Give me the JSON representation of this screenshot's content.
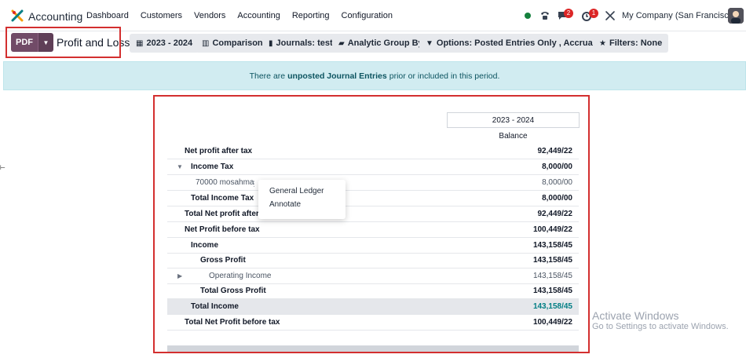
{
  "app": {
    "name": "Accounting"
  },
  "menu": [
    "Dashboard",
    "Customers",
    "Vendors",
    "Accounting",
    "Reporting",
    "Configuration"
  ],
  "systray": {
    "messages_count": "2",
    "activities_count": "1",
    "company": "My Company (San Francisco)"
  },
  "control": {
    "pdf_label": "PDF",
    "report_title": "Profit and Loss",
    "filters": [
      {
        "icon": "calendar-icon",
        "label": "2023 - 2024"
      },
      {
        "icon": "bar-chart-icon",
        "label": "Comparison"
      },
      {
        "icon": "book-icon",
        "label": "Journals: test"
      },
      {
        "icon": "folder-open-icon",
        "label": "Analytic Group By"
      },
      {
        "icon": "filter-icon",
        "label": "Options: Posted Entries Only , Accrual Basis"
      },
      {
        "icon": "star-icon",
        "label": "Filters: None"
      }
    ]
  },
  "alert": {
    "prefix": "There are",
    "link": "unposted Journal Entries",
    "suffix": "prior or included in this period."
  },
  "report": {
    "period": "2023 - 2024",
    "column_header": "Balance",
    "rows": [
      {
        "label": "Net profit after tax",
        "value": "92,449/22"
      },
      {
        "label": "Income Tax",
        "value": "8,000/00"
      },
      {
        "label": "70000 mosahma",
        "value": "8,000/00"
      },
      {
        "label": "Total Income Tax",
        "value": "8,000/00"
      },
      {
        "label": "Total Net profit after t",
        "value": "92,449/22"
      },
      {
        "label": "Net Profit before tax",
        "value": "100,449/22"
      },
      {
        "label": "Income",
        "value": "143,158/45"
      },
      {
        "label": "Gross Profit",
        "value": "143,158/45"
      },
      {
        "label": "Operating Income",
        "value": "143,158/45"
      },
      {
        "label": "Total Gross Profit",
        "value": "143,158/45"
      },
      {
        "label": "Total Income",
        "value": "143,158/45"
      },
      {
        "label": "Total Net Profit before tax",
        "value": "100,449/22"
      }
    ]
  },
  "context_menu": {
    "items": [
      "General Ledger",
      "Annotate"
    ]
  },
  "watermark": {
    "line1": "Activate Windows",
    "line2": "Go to Settings to activate Windows."
  },
  "colors": {
    "primary": "#714b67",
    "alert_bg": "#d1ecf1",
    "highlight": "#d32f2f",
    "teal": "#017e84"
  }
}
